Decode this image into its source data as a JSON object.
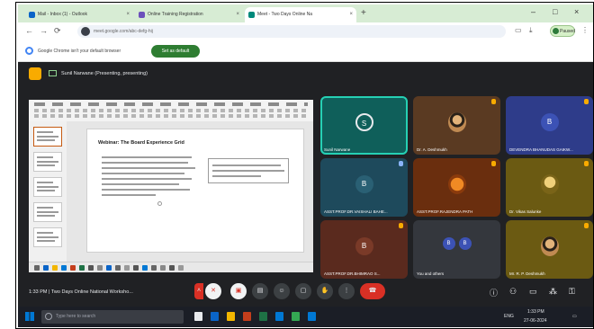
{
  "browser": {
    "tabs": [
      {
        "label": "Mail - Inbox (1) - Outlook"
      },
      {
        "label": "Online Training Registration"
      },
      {
        "label": "Meet - Two Days Online Na"
      }
    ],
    "new_tab": "+",
    "controls": {
      "minimize": "–",
      "maximize": "□",
      "close": "×"
    },
    "url": "meet.google.com/abc-defg-hij",
    "profile_label": "Paused",
    "info_message": "Google Chrome isn't your default browser",
    "info_button": "Set as default"
  },
  "meet": {
    "presenting_text": "Sunil Narwane (Presenting, presenting)",
    "slide": {
      "title": "Webinar: The Board Experience Grid"
    },
    "participants": [
      {
        "name": "Sunil Narwane",
        "initial": "S",
        "color": "#0f5f5a"
      },
      {
        "name": "Dr. A. Deshmukh",
        "initial": "",
        "color": "#5a3a22"
      },
      {
        "name": "DEVENDRA BHANUDAS GAIKW...",
        "initial": "B",
        "color": "#2e3c8a"
      },
      {
        "name": "ASST.PROF.DR.VAISHALI BAHE...",
        "initial": "B",
        "color": "#1e4a5c"
      },
      {
        "name": "ASST.PROF.RAJENDRA PATH",
        "initial": "",
        "color": "#6a2e0e"
      },
      {
        "name": "Dr. Vikas Salunke",
        "initial": "",
        "color": "#6b5a12"
      },
      {
        "name": "ASST.PROF.DR.BHIMRAO S...",
        "initial": "B",
        "color": "#5a2a1e"
      },
      {
        "name": "You and others",
        "initial": "B",
        "color": "#34373d"
      },
      {
        "name": "Mr. R. P. Deshmukh",
        "initial": "",
        "color": "#6b5a12"
      }
    ],
    "meeting_time": "1:33 PM",
    "meeting_title": "Two Days Online National Worksho..."
  },
  "taskbar": {
    "search_placeholder": "Type here to search",
    "clock_time": "1:33 PM",
    "clock_date": "27-06-2024",
    "tray_lang": "ENG"
  },
  "colors": {
    "tab_strip": "#d7ecd4",
    "meet_bg": "#202124",
    "end_call": "#d93025",
    "accent_green": "#2e7d32"
  }
}
